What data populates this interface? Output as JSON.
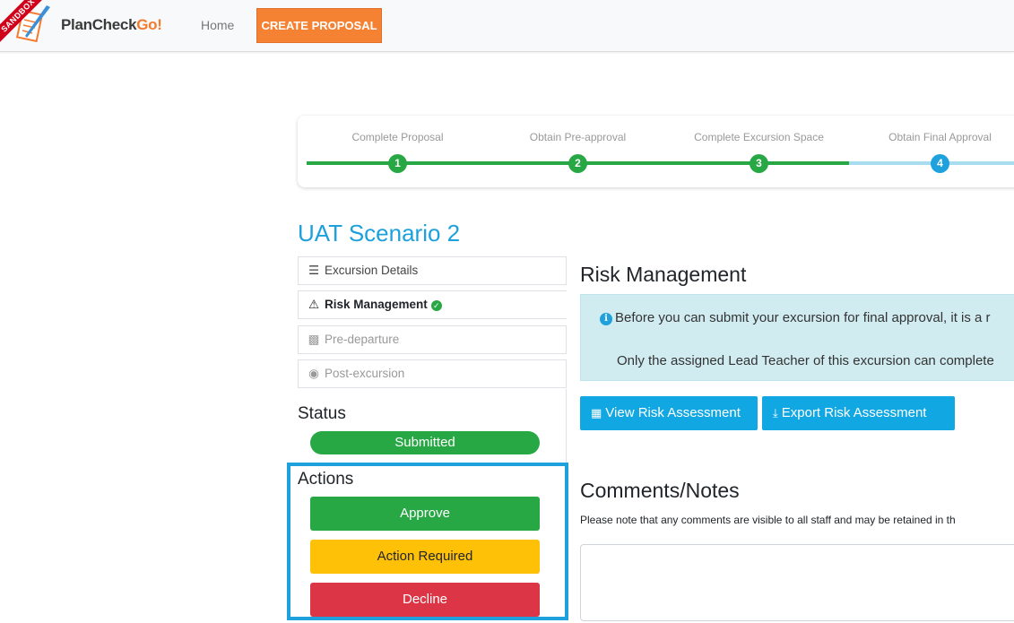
{
  "navbar": {
    "ribbon": "SANDBOX",
    "brand_plan_check": "PlanCheck",
    "brand_go": "Go!",
    "home_label": "Home",
    "create_label": "CREATE PROPOSAL"
  },
  "stepper": {
    "steps": [
      {
        "label": "Complete Proposal",
        "number": "1",
        "status": "done"
      },
      {
        "label": "Obtain Pre-approval",
        "number": "2",
        "status": "done"
      },
      {
        "label": "Complete Excursion Space",
        "number": "3",
        "status": "done"
      },
      {
        "label": "Obtain Final Approval",
        "number": "4",
        "status": "current"
      }
    ],
    "colors": {
      "done": "#28a745",
      "current": "#1ea1dc",
      "pending_line": "#a8dcef"
    }
  },
  "page_title": "UAT Scenario 2",
  "sidebar": {
    "items": [
      {
        "label": "Excursion Details",
        "icon": "list-icon"
      },
      {
        "label": "Risk Management",
        "icon": "warning-icon"
      },
      {
        "label": "Pre-departure",
        "icon": "suitcase-icon"
      },
      {
        "label": "Post-excursion",
        "icon": "thumbs-up-icon"
      }
    ]
  },
  "status": {
    "heading": "Status",
    "value": "Submitted"
  },
  "actions": {
    "heading": "Actions",
    "approve": "Approve",
    "action_required": "Action Required",
    "decline": "Decline"
  },
  "main": {
    "heading": "Risk Management",
    "info_line1": "Before you can submit your excursion for final approval, it is a r",
    "info_line2": "Only the assigned Lead Teacher of this excursion can complete",
    "view_button": "View Risk Assessment",
    "export_button": "Export Risk Assessment",
    "comments_heading": "Comments/Notes",
    "comments_note": "Please note that any comments are visible to all staff and may be retained in th"
  }
}
